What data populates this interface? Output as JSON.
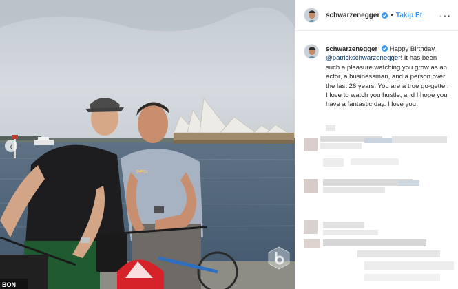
{
  "post": {
    "username": "schwarzenegger",
    "follow_label": "Takip Et",
    "separator": "•",
    "more_label": "···",
    "caption_username": "schwarzenegger",
    "caption_part1": " Happy Birthday, ",
    "caption_mention": "@patrickschwarzenegger",
    "caption_part2": "! It has been such a pleasure watching you grow as an actor, a businessman, and a person over the last 26 years. You are a true go-getter. I love to watch you hustle, and I hope you have a fantastic day. I love you."
  },
  "photo": {
    "prev_arrow": "‹"
  },
  "icons": {
    "verified": "verified-badge-icon",
    "more": "more-options-icon",
    "prev": "chevron-left-icon",
    "watermark": "watermark-logo-icon"
  },
  "colors": {
    "accent": "#3897f0",
    "mention": "#003569",
    "text": "#262626",
    "border": "#efefef"
  }
}
